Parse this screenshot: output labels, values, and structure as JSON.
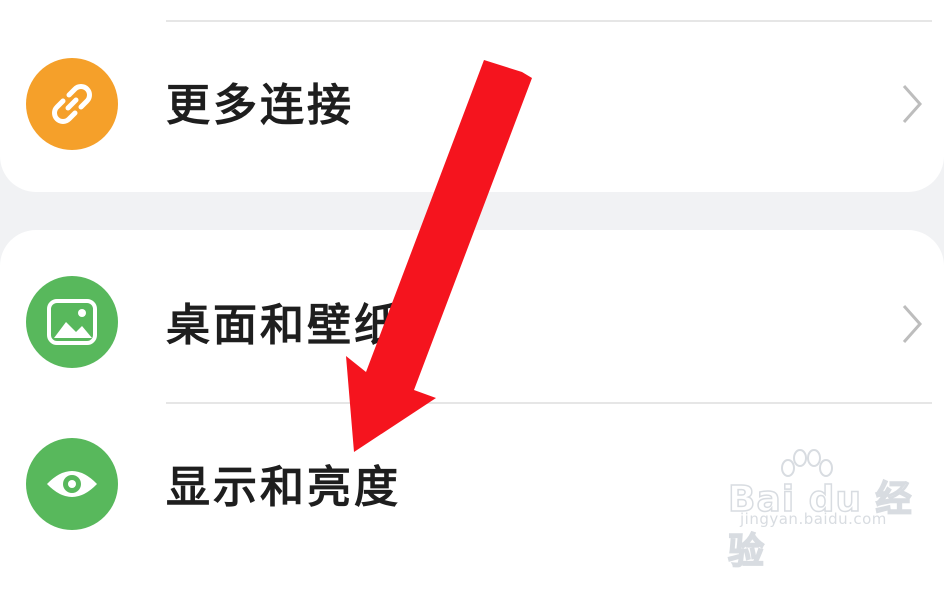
{
  "settings": {
    "items": [
      {
        "label": "更多连接",
        "icon": "link-icon",
        "icon_color": "#f5a02a"
      },
      {
        "label": "桌面和壁纸",
        "icon": "image-icon",
        "icon_color": "#58b85c"
      },
      {
        "label": "显示和亮度",
        "icon": "eye-icon",
        "icon_color": "#58b85c"
      }
    ]
  },
  "annotation": {
    "arrow_color": "#f5141e"
  },
  "watermark": {
    "logo": "Bai du 经验",
    "url": "jingyan.baidu.com"
  }
}
